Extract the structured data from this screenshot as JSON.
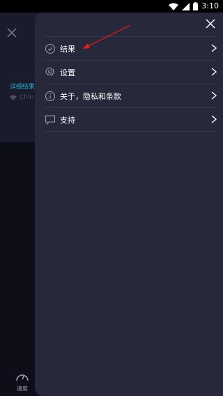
{
  "status_bar": {
    "time": "3:10"
  },
  "background_app": {
    "detail_label": "详细结果",
    "network_label": "Chin",
    "speed_tab_label": "速度"
  },
  "menu": {
    "items": [
      {
        "label": "结果",
        "icon": "check-circle-icon"
      },
      {
        "label": "设置",
        "icon": "gear-icon"
      },
      {
        "label": "关于，隐私和条款",
        "icon": "info-icon"
      },
      {
        "label": "支持",
        "icon": "chat-bubble-icon"
      }
    ]
  },
  "colors": {
    "drawer_bg": "#272839",
    "accent": "#25a7c7",
    "annotation": "#e2211c"
  }
}
